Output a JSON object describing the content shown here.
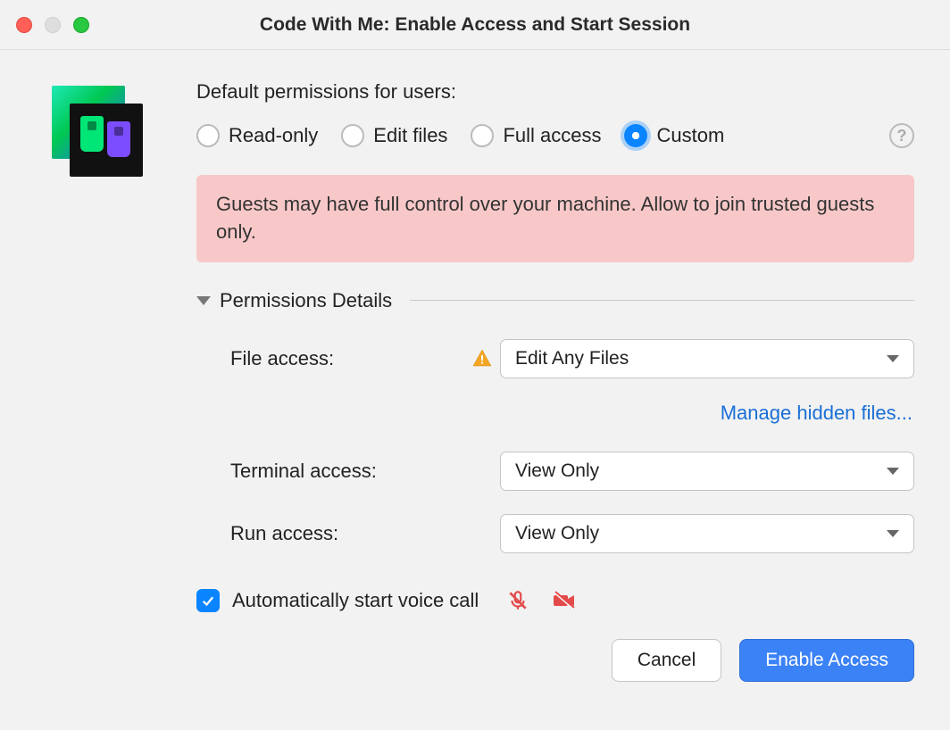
{
  "window": {
    "title": "Code With Me: Enable Access and Start Session"
  },
  "header": {
    "section_title": "Default permissions for users:"
  },
  "radios": {
    "readonly": "Read-only",
    "editfiles": "Edit files",
    "fullaccess": "Full access",
    "custom": "Custom"
  },
  "warning": {
    "text": "Guests may have full control over your machine. Allow to join trusted guests only."
  },
  "details": {
    "title": "Permissions Details",
    "file_access_label": "File access:",
    "file_access_value": "Edit Any Files",
    "manage_hidden_link": "Manage hidden files...",
    "terminal_access_label": "Terminal access:",
    "terminal_access_value": "View Only",
    "run_access_label": "Run access:",
    "run_access_value": "View Only"
  },
  "voice": {
    "label": "Automatically start voice call"
  },
  "buttons": {
    "cancel": "Cancel",
    "enable": "Enable Access"
  },
  "help": {
    "symbol": "?"
  }
}
